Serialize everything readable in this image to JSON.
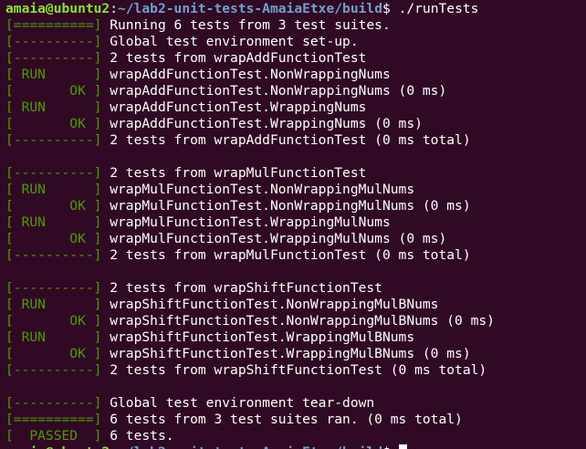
{
  "prompt": {
    "user": "amaia@ubuntu2",
    "sep": ":",
    "path": "~/lab2-unit-tests-AmaiaEtxe/build",
    "symbol": "$",
    "command": " ./runTests"
  },
  "lines": [
    {
      "tag": "[==========]",
      "msg": "Running 6 tests from 3 test suites."
    },
    {
      "tag": "[----------]",
      "msg": "Global test environment set-up."
    },
    {
      "tag": "[----------]",
      "msg": "2 tests from wrapAddFunctionTest"
    },
    {
      "tag": "[ RUN      ]",
      "msg": "wrapAddFunctionTest.NonWrappingNums"
    },
    {
      "tag": "[       OK ]",
      "msg": "wrapAddFunctionTest.NonWrappingNums (0 ms)"
    },
    {
      "tag": "[ RUN      ]",
      "msg": "wrapAddFunctionTest.WrappingNums"
    },
    {
      "tag": "[       OK ]",
      "msg": "wrapAddFunctionTest.WrappingNums (0 ms)"
    },
    {
      "tag": "[----------]",
      "msg": "2 tests from wrapAddFunctionTest (0 ms total)"
    },
    {
      "tag": "",
      "msg": ""
    },
    {
      "tag": "[----------]",
      "msg": "2 tests from wrapMulFunctionTest"
    },
    {
      "tag": "[ RUN      ]",
      "msg": "wrapMulFunctionTest.NonWrappingMulNums"
    },
    {
      "tag": "[       OK ]",
      "msg": "wrapMulFunctionTest.NonWrappingMulNums (0 ms)"
    },
    {
      "tag": "[ RUN      ]",
      "msg": "wrapMulFunctionTest.WrappingMulNums"
    },
    {
      "tag": "[       OK ]",
      "msg": "wrapMulFunctionTest.WrappingMulNums (0 ms)"
    },
    {
      "tag": "[----------]",
      "msg": "2 tests from wrapMulFunctionTest (0 ms total)"
    },
    {
      "tag": "",
      "msg": ""
    },
    {
      "tag": "[----------]",
      "msg": "2 tests from wrapShiftFunctionTest"
    },
    {
      "tag": "[ RUN      ]",
      "msg": "wrapShiftFunctionTest.NonWrappingMulBNums"
    },
    {
      "tag": "[       OK ]",
      "msg": "wrapShiftFunctionTest.NonWrappingMulBNums (0 ms)"
    },
    {
      "tag": "[ RUN      ]",
      "msg": "wrapShiftFunctionTest.WrappingMulBNums"
    },
    {
      "tag": "[       OK ]",
      "msg": "wrapShiftFunctionTest.WrappingMulBNums (0 ms)"
    },
    {
      "tag": "[----------]",
      "msg": "2 tests from wrapShiftFunctionTest (0 ms total)"
    },
    {
      "tag": "",
      "msg": ""
    },
    {
      "tag": "[----------]",
      "msg": "Global test environment tear-down"
    },
    {
      "tag": "[==========]",
      "msg": "6 tests from 3 test suites ran. (0 ms total)"
    },
    {
      "tag": "[  PASSED  ]",
      "msg": "6 tests."
    }
  ],
  "colors": {
    "background": "#300a24",
    "tag_green": "#4e9a06",
    "user_green": "#8ae234",
    "path_blue": "#729fcf",
    "text": "#ffffff"
  }
}
